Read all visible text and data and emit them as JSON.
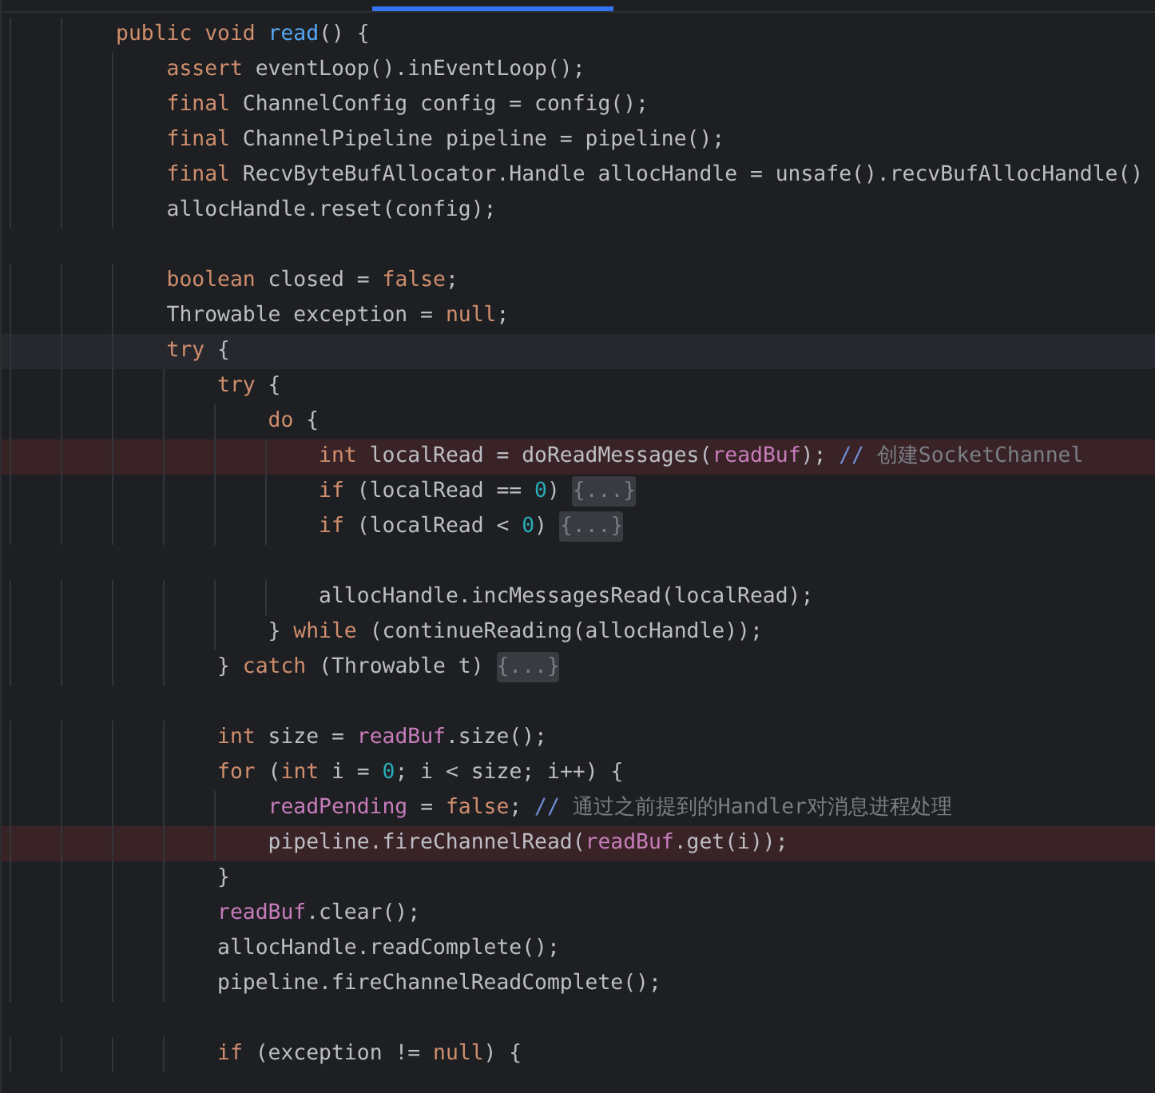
{
  "lines": [
    {
      "highlighted": false,
      "current": false,
      "tokens": [
        {
          "text": "        public void ",
          "kind": "kw"
        },
        {
          "text": "read",
          "kind": "fn"
        },
        {
          "text": "() {",
          "kind": "plain"
        }
      ]
    },
    {
      "highlighted": false,
      "current": false,
      "tokens": [
        {
          "text": "            assert ",
          "kind": "kw"
        },
        {
          "text": "eventLoop().inEventLoop();",
          "kind": "plain"
        }
      ]
    },
    {
      "highlighted": false,
      "current": false,
      "tokens": [
        {
          "text": "            final ",
          "kind": "kw"
        },
        {
          "text": "ChannelConfig config = config();",
          "kind": "plain"
        }
      ]
    },
    {
      "highlighted": false,
      "current": false,
      "tokens": [
        {
          "text": "            final ",
          "kind": "kw"
        },
        {
          "text": "ChannelPipeline pipeline = pipeline();",
          "kind": "plain"
        }
      ]
    },
    {
      "highlighted": false,
      "current": false,
      "tokens": [
        {
          "text": "            final ",
          "kind": "kw"
        },
        {
          "text": "RecvByteBufAllocator.Handle allocHandle = unsafe().recvBufAllocHandle()",
          "kind": "plain"
        }
      ]
    },
    {
      "highlighted": false,
      "current": false,
      "tokens": [
        {
          "text": "            allocHandle.reset(config);",
          "kind": "plain"
        }
      ]
    },
    {
      "highlighted": false,
      "current": false
    },
    {
      "highlighted": false,
      "current": false,
      "tokens": [
        {
          "text": "            boolean ",
          "kind": "kw"
        },
        {
          "text": "closed = ",
          "kind": "plain"
        },
        {
          "text": "false",
          "kind": "kw"
        },
        {
          "text": ";",
          "kind": "plain"
        }
      ]
    },
    {
      "highlighted": false,
      "current": false,
      "tokens": [
        {
          "text": "            Throwable exception = ",
          "kind": "plain"
        },
        {
          "text": "null",
          "kind": "kw"
        },
        {
          "text": ";",
          "kind": "plain"
        }
      ]
    },
    {
      "highlighted": false,
      "current": true,
      "tokens": [
        {
          "text": "            try ",
          "kind": "kw"
        },
        {
          "text": "{",
          "kind": "plain"
        }
      ]
    },
    {
      "highlighted": false,
      "current": false,
      "tokens": [
        {
          "text": "                try ",
          "kind": "kw"
        },
        {
          "text": "{",
          "kind": "plain"
        }
      ]
    },
    {
      "highlighted": false,
      "current": false,
      "tokens": [
        {
          "text": "                    do ",
          "kind": "kw"
        },
        {
          "text": "{",
          "kind": "plain"
        }
      ]
    },
    {
      "highlighted": true,
      "current": false,
      "tokens": [
        {
          "text": "                        int ",
          "kind": "kw"
        },
        {
          "text": "localRead = doReadMessages(",
          "kind": "plain"
        },
        {
          "text": "readBuf",
          "kind": "field"
        },
        {
          "text": "); ",
          "kind": "plain"
        },
        {
          "text": "// ",
          "kind": "slash"
        },
        {
          "text": "创建SocketChannel",
          "kind": "comment"
        }
      ]
    },
    {
      "highlighted": false,
      "current": false,
      "tokens": [
        {
          "text": "                        if ",
          "kind": "kw"
        },
        {
          "text": "(localRead == ",
          "kind": "plain"
        },
        {
          "text": "0",
          "kind": "num"
        },
        {
          "text": ") ",
          "kind": "plain"
        },
        {
          "text": "{...}",
          "kind": "fold"
        }
      ]
    },
    {
      "highlighted": false,
      "current": false,
      "tokens": [
        {
          "text": "                        if ",
          "kind": "kw"
        },
        {
          "text": "(localRead < ",
          "kind": "plain"
        },
        {
          "text": "0",
          "kind": "num"
        },
        {
          "text": ") ",
          "kind": "plain"
        },
        {
          "text": "{...}",
          "kind": "fold"
        }
      ]
    },
    {
      "highlighted": false,
      "current": false
    },
    {
      "highlighted": false,
      "current": false,
      "tokens": [
        {
          "text": "                        allocHandle.incMessagesRead(localRead);",
          "kind": "plain"
        }
      ]
    },
    {
      "highlighted": false,
      "current": false,
      "tokens": [
        {
          "text": "                    } ",
          "kind": "plain"
        },
        {
          "text": "while ",
          "kind": "kw"
        },
        {
          "text": "(continueReading(allocHandle));",
          "kind": "plain"
        }
      ]
    },
    {
      "highlighted": false,
      "current": false,
      "tokens": [
        {
          "text": "                } ",
          "kind": "plain"
        },
        {
          "text": "catch ",
          "kind": "kw"
        },
        {
          "text": "(Throwable t) ",
          "kind": "plain"
        },
        {
          "text": "{...}",
          "kind": "fold"
        }
      ]
    },
    {
      "highlighted": false,
      "current": false
    },
    {
      "highlighted": false,
      "current": false,
      "tokens": [
        {
          "text": "                int ",
          "kind": "kw"
        },
        {
          "text": "size = ",
          "kind": "plain"
        },
        {
          "text": "readBuf",
          "kind": "field"
        },
        {
          "text": ".size();",
          "kind": "plain"
        }
      ]
    },
    {
      "highlighted": false,
      "current": false,
      "tokens": [
        {
          "text": "                for ",
          "kind": "kw"
        },
        {
          "text": "(",
          "kind": "plain"
        },
        {
          "text": "int ",
          "kind": "kw"
        },
        {
          "text": "i = ",
          "kind": "plain"
        },
        {
          "text": "0",
          "kind": "num"
        },
        {
          "text": "; i < size; i++) {",
          "kind": "plain"
        }
      ]
    },
    {
      "highlighted": false,
      "current": false,
      "tokens": [
        {
          "text": "                    readPending",
          "kind": "field"
        },
        {
          "text": " = ",
          "kind": "plain"
        },
        {
          "text": "false",
          "kind": "kw"
        },
        {
          "text": "; ",
          "kind": "plain"
        },
        {
          "text": "// ",
          "kind": "slash"
        },
        {
          "text": "通过之前提到的Handler对消息进程处理",
          "kind": "comment"
        }
      ]
    },
    {
      "highlighted": true,
      "current": false,
      "tokens": [
        {
          "text": "                    pipeline.fireChannelRead(",
          "kind": "plain"
        },
        {
          "text": "readBuf",
          "kind": "field"
        },
        {
          "text": ".get(i));",
          "kind": "plain"
        }
      ]
    },
    {
      "highlighted": false,
      "current": false,
      "tokens": [
        {
          "text": "                }",
          "kind": "plain"
        }
      ]
    },
    {
      "highlighted": false,
      "current": false,
      "tokens": [
        {
          "text": "                readBuf",
          "kind": "field"
        },
        {
          "text": ".clear();",
          "kind": "plain"
        }
      ]
    },
    {
      "highlighted": false,
      "current": false,
      "tokens": [
        {
          "text": "                allocHandle.readComplete();",
          "kind": "plain"
        }
      ]
    },
    {
      "highlighted": false,
      "current": false,
      "tokens": [
        {
          "text": "                pipeline.fireChannelReadComplete();",
          "kind": "plain"
        }
      ]
    },
    {
      "highlighted": false,
      "current": false
    },
    {
      "highlighted": false,
      "current": false,
      "tokens": [
        {
          "text": "                if ",
          "kind": "kw"
        },
        {
          "text": "(exception != ",
          "kind": "plain"
        },
        {
          "text": "null",
          "kind": "kw"
        },
        {
          "text": ") {",
          "kind": "plain"
        }
      ]
    }
  ]
}
